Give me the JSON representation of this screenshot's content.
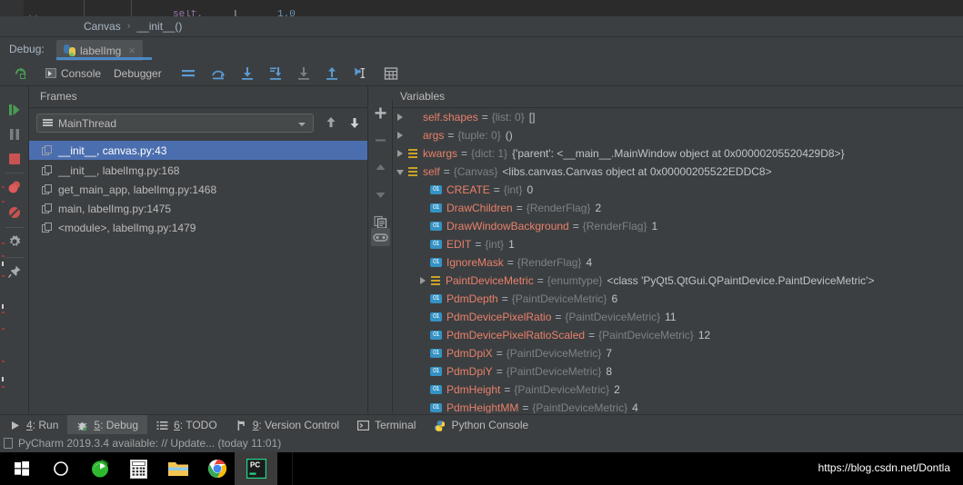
{
  "colors": {
    "panel_bg": "#3c3f41",
    "editor_bg": "#2b2b2b",
    "accent_blue": "#4a88c7",
    "selection_blue": "#4b6eaf",
    "var_name": "#e8806b",
    "var_type": "#7d8185",
    "text": "#bbbbbb",
    "taskbar_bg": "#000000"
  },
  "breadcrumb": {
    "items": [
      "Canvas",
      "__init__()"
    ],
    "separator": "›"
  },
  "debug_window": {
    "label": "Debug:",
    "tab": {
      "name": "labelImg",
      "icon": "python-icon",
      "close_icon": "×"
    }
  },
  "debug_toolbar": {
    "rerun_icon": "rerun-icon",
    "tabs": [
      {
        "label": "Console",
        "icon": "console-icon",
        "active": false
      },
      {
        "label": "Debugger",
        "icon": "",
        "active": true
      }
    ],
    "actions": [
      "layout-settings-icon",
      "step-over-icon",
      "step-into-icon",
      "force-step-into-icon",
      "step-into-my-code-icon",
      "step-out-icon",
      "run-to-cursor-icon",
      "evaluate-expression-icon"
    ]
  },
  "left_actions": [
    "resume-program-icon",
    "pause-program-icon",
    "stop-icon",
    "view-breakpoints-icon",
    "mute-breakpoints-icon",
    "settings-icon",
    "pin-tab-icon"
  ],
  "frames": {
    "title": "Frames",
    "thread_selector": {
      "value": "MainThread",
      "icon": "thread-icon",
      "caret": "chevron-down-icon"
    },
    "nav_up_icon": "arrow-up-icon",
    "nav_down_icon": "arrow-down-icon",
    "items": [
      {
        "label": "__init__, canvas.py:43",
        "selected": true
      },
      {
        "label": "__init__, labelImg.py:168",
        "selected": false
      },
      {
        "label": "get_main_app, labelImg.py:1468",
        "selected": false
      },
      {
        "label": "main, labelImg.py:1475",
        "selected": false
      },
      {
        "label": "<module>, labelImg.py:1479",
        "selected": false
      }
    ]
  },
  "variables": {
    "title": "Variables",
    "side_actions": [
      "add-watch-icon",
      "remove-watch-icon",
      "move-up-icon",
      "move-down-icon",
      "copy-value-icon",
      "inline-watches-icon"
    ],
    "rows": [
      {
        "indent": 0,
        "toggle": "closed",
        "icon": "list",
        "name": "self.shapes",
        "type": "{list: 0}",
        "value": "[]"
      },
      {
        "indent": 0,
        "toggle": "closed",
        "icon": "list",
        "name": "args",
        "type": "{tuple: 0}",
        "value": "()"
      },
      {
        "indent": 0,
        "toggle": "closed",
        "icon": "dict",
        "name": "kwargs",
        "type": "{dict: 1}",
        "value": "{'parent': <__main__.MainWindow object at 0x00000205520429D8>}"
      },
      {
        "indent": 0,
        "toggle": "open",
        "icon": "dict",
        "name": "self",
        "type": "{Canvas}",
        "value": "<libs.canvas.Canvas object at 0x00000205522EDDC8>"
      },
      {
        "indent": 1,
        "toggle": "none",
        "icon": "int",
        "name": "CREATE",
        "type": "{int}",
        "value": "0"
      },
      {
        "indent": 1,
        "toggle": "none",
        "icon": "int",
        "name": "DrawChildren",
        "type": "{RenderFlag}",
        "value": "2"
      },
      {
        "indent": 1,
        "toggle": "none",
        "icon": "int",
        "name": "DrawWindowBackground",
        "type": "{RenderFlag}",
        "value": "1"
      },
      {
        "indent": 1,
        "toggle": "none",
        "icon": "int",
        "name": "EDIT",
        "type": "{int}",
        "value": "1"
      },
      {
        "indent": 1,
        "toggle": "none",
        "icon": "int",
        "name": "IgnoreMask",
        "type": "{RenderFlag}",
        "value": "4"
      },
      {
        "indent": 1,
        "toggle": "closed",
        "icon": "dict",
        "name": "PaintDeviceMetric",
        "type": "{enumtype}",
        "value": "<class 'PyQt5.QtGui.QPaintDevice.PaintDeviceMetric'>"
      },
      {
        "indent": 1,
        "toggle": "none",
        "icon": "int",
        "name": "PdmDepth",
        "type": "{PaintDeviceMetric}",
        "value": "6"
      },
      {
        "indent": 1,
        "toggle": "none",
        "icon": "int",
        "name": "PdmDevicePixelRatio",
        "type": "{PaintDeviceMetric}",
        "value": "11"
      },
      {
        "indent": 1,
        "toggle": "none",
        "icon": "int",
        "name": "PdmDevicePixelRatioScaled",
        "type": "{PaintDeviceMetric}",
        "value": "12"
      },
      {
        "indent": 1,
        "toggle": "none",
        "icon": "int",
        "name": "PdmDpiX",
        "type": "{PaintDeviceMetric}",
        "value": "7"
      },
      {
        "indent": 1,
        "toggle": "none",
        "icon": "int",
        "name": "PdmDpiY",
        "type": "{PaintDeviceMetric}",
        "value": "8"
      },
      {
        "indent": 1,
        "toggle": "none",
        "icon": "int",
        "name": "PdmHeight",
        "type": "{PaintDeviceMetric}",
        "value": "2"
      },
      {
        "indent": 1,
        "toggle": "none",
        "icon": "int",
        "name": "PdmHeightMM",
        "type": "{PaintDeviceMetric}",
        "value": "4"
      }
    ]
  },
  "bottom_bar": {
    "items": [
      {
        "num": "4",
        "label": ": Run",
        "icon": "run-icon",
        "active": false
      },
      {
        "num": "5",
        "label": ": Debug",
        "icon": "debug-bug-icon",
        "active": true
      },
      {
        "num": "6",
        "label": ": TODO",
        "icon": "todo-icon",
        "active": false
      },
      {
        "num": "9",
        "label": ": Version Control",
        "icon": "branch-icon",
        "active": false
      },
      {
        "num": "",
        "label": "Terminal",
        "icon": "terminal-icon",
        "active": false
      },
      {
        "num": "",
        "label": "Python Console",
        "icon": "python-console-icon",
        "active": false
      }
    ]
  },
  "status_bar": {
    "icon": "event-log-icon",
    "text": "PyCharm 2019.3.4 available: // Update... (today 11:01)"
  },
  "taskbar": {
    "buttons": [
      "windows-start-icon",
      "cortana-search-icon",
      "browser-360-icon",
      "calculator-icon",
      "file-explorer-icon",
      "chrome-icon",
      "pycharm-icon"
    ],
    "watermark": "https://blog.csdn.net/Dontla"
  }
}
